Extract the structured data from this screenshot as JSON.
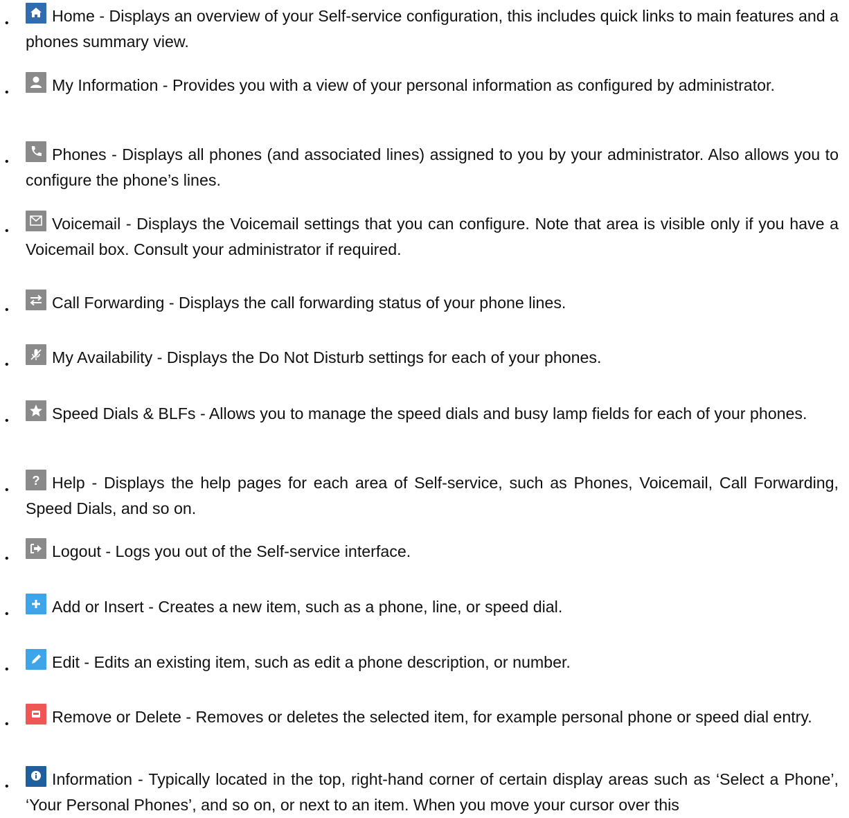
{
  "items": [
    {
      "icon": "home-icon",
      "icon_color": "#2f6cb0",
      "label": "Home",
      "description": "Displays an overview of your Self-service configuration, this includes quick links to main features and a phones summary view."
    },
    {
      "icon": "user-icon",
      "icon_color": "#8a8a8a",
      "label": "My Information",
      "description": "Provides you with a view of your personal information as configured by administrator."
    },
    {
      "icon": "phone-icon",
      "icon_color": "#8a8a8a",
      "label": "Phones",
      "description": "Displays all phones (and associated lines) assigned to you by your administrator. Also allows you to configure the phone’s lines."
    },
    {
      "icon": "envelope-icon",
      "icon_color": "#8a8a8a",
      "label": "Voicemail",
      "description": "Displays the Voicemail settings that you can configure. Note that area is visible only if you have a Voicemail box. Consult your administrator if required."
    },
    {
      "icon": "forward-arrows-icon",
      "icon_color": "#8a8a8a",
      "label": "Call Forwarding",
      "description": "Displays the call forwarding status of your phone lines."
    },
    {
      "icon": "mic-off-icon",
      "icon_color": "#8a8a8a",
      "label": "My Availability",
      "description": "Displays the Do Not Disturb settings for each of your phones."
    },
    {
      "icon": "star-icon",
      "icon_color": "#8a8a8a",
      "label": "Speed Dials & BLFs",
      "description": "Allows you to manage the speed dials and busy lamp fields for each of your phones."
    },
    {
      "icon": "question-icon",
      "icon_color": "#8a8a8a",
      "label": "Help",
      "description": "Displays the help pages for each area of Self-service, such as Phones, Voicemail, Call Forwarding, Speed Dials, and so on."
    },
    {
      "icon": "logout-icon",
      "icon_color": "#8a8a8a",
      "label": "Logout",
      "description": "Logs you out of the Self-service interface."
    },
    {
      "icon": "plus-icon",
      "icon_color": "#3ea6e8",
      "label": "Add or Insert",
      "description": "Creates a new item, such as a phone, line, or speed dial."
    },
    {
      "icon": "pencil-icon",
      "icon_color": "#3ea6e8",
      "label": "Edit",
      "description": "Edits an existing item, such as edit a phone description, or number."
    },
    {
      "icon": "trash-icon",
      "icon_color": "#ef5656",
      "label": "Remove or Delete",
      "description": "Removes or deletes the selected item, for example personal phone or speed dial entry."
    },
    {
      "icon": "info-icon",
      "icon_color": "#1f5f9e",
      "label": "Information",
      "description": "Typically located in the top, right-hand corner of certain display areas such as ‘Select a Phone’, ‘Your Personal Phones’, and so on, or next to an item. When you move your cursor over this"
    }
  ],
  "separator": " - ",
  "bullet": "•"
}
